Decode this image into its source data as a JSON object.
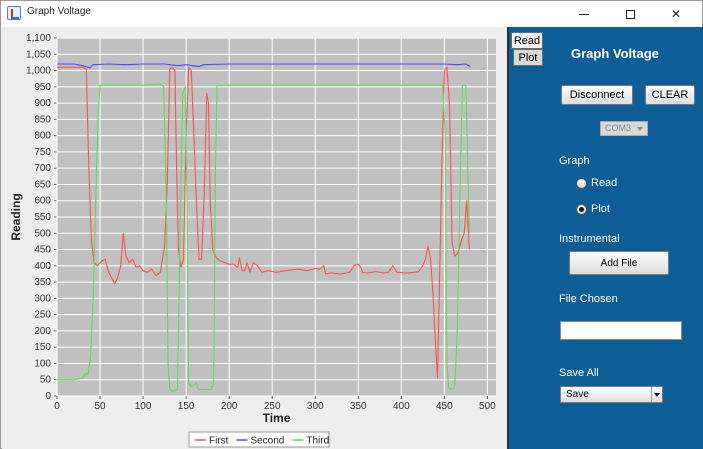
{
  "window": {
    "title": "Graph Voltage",
    "minimize_icon": "minimize-icon",
    "maximize_icon": "maximize-icon",
    "close_glyph": "✕"
  },
  "colors": {
    "plot_background": "#c0c0c0",
    "gridline": "#ffffff",
    "side_panel": "#0d5d96",
    "series_first": "#ff5050",
    "series_second": "#4a4aff",
    "series_third": "#55e055"
  },
  "tabs": {
    "read": "Read",
    "plot": "Plot"
  },
  "controls": {
    "heading": "Graph Voltage",
    "disconnect_label": "Disconnect",
    "clear_label": "CLEAR",
    "port_value": "COM3",
    "graph_label": "Graph",
    "radio_read_label": "Read",
    "radio_plot_label": "Plot",
    "radio_selected": "Plot",
    "instrumental_label": "Instrumental",
    "add_file_label": "Add File",
    "file_chosen_label": "File Chosen",
    "file_chosen_value": "",
    "save_all_label": "Save All",
    "save_value": "Save"
  },
  "chart_data": {
    "type": "line",
    "xlabel": "Time",
    "ylabel": "Reading",
    "xlim": [
      0,
      510
    ],
    "ylim": [
      0,
      1100
    ],
    "xticks": [
      0,
      50,
      100,
      150,
      200,
      250,
      300,
      350,
      400,
      450,
      500
    ],
    "yticks": [
      0,
      50,
      100,
      150,
      200,
      250,
      300,
      350,
      400,
      450,
      500,
      550,
      600,
      650,
      700,
      750,
      800,
      850,
      900,
      950,
      1000,
      1050,
      1100
    ],
    "grid": true,
    "legend_position": "bottom-center",
    "series": [
      {
        "name": "First",
        "color": "#ff5050",
        "points": [
          [
            0,
            1010
          ],
          [
            10,
            1010
          ],
          [
            20,
            1010
          ],
          [
            30,
            1010
          ],
          [
            34,
            1005
          ],
          [
            37,
            700
          ],
          [
            40,
            480
          ],
          [
            43,
            410
          ],
          [
            47,
            400
          ],
          [
            52,
            415
          ],
          [
            56,
            420
          ],
          [
            60,
            380
          ],
          [
            64,
            360
          ],
          [
            67,
            345
          ],
          [
            70,
            360
          ],
          [
            74,
            400
          ],
          [
            77,
            500
          ],
          [
            80,
            430
          ],
          [
            84,
            410
          ],
          [
            88,
            420
          ],
          [
            92,
            395
          ],
          [
            96,
            400
          ],
          [
            100,
            385
          ],
          [
            105,
            380
          ],
          [
            110,
            390
          ],
          [
            115,
            370
          ],
          [
            120,
            380
          ],
          [
            125,
            460
          ],
          [
            128,
            650
          ],
          [
            131,
            1005
          ],
          [
            134,
            1010
          ],
          [
            137,
            1000
          ],
          [
            139,
            700
          ],
          [
            141,
            450
          ],
          [
            144,
            395
          ],
          [
            147,
            420
          ],
          [
            150,
            800
          ],
          [
            153,
            1010
          ],
          [
            156,
            1000
          ],
          [
            159,
            800
          ],
          [
            162,
            600
          ],
          [
            165,
            420
          ],
          [
            168,
            420
          ],
          [
            171,
            620
          ],
          [
            174,
            930
          ],
          [
            176,
            900
          ],
          [
            178,
            600
          ],
          [
            181,
            450
          ],
          [
            185,
            425
          ],
          [
            190,
            415
          ],
          [
            195,
            410
          ],
          [
            200,
            405
          ],
          [
            205,
            405
          ],
          [
            210,
            395
          ],
          [
            212,
            425
          ],
          [
            215,
            385
          ],
          [
            218,
            385
          ],
          [
            221,
            410
          ],
          [
            224,
            380
          ],
          [
            228,
            410
          ],
          [
            233,
            400
          ],
          [
            238,
            380
          ],
          [
            245,
            385
          ],
          [
            255,
            380
          ],
          [
            265,
            385
          ],
          [
            280,
            390
          ],
          [
            290,
            385
          ],
          [
            300,
            392
          ],
          [
            305,
            390
          ],
          [
            310,
            400
          ],
          [
            312,
            375
          ],
          [
            318,
            378
          ],
          [
            330,
            375
          ],
          [
            340,
            380
          ],
          [
            345,
            400
          ],
          [
            350,
            405
          ],
          [
            353,
            395
          ],
          [
            355,
            380
          ],
          [
            360,
            378
          ],
          [
            370,
            382
          ],
          [
            380,
            378
          ],
          [
            385,
            380
          ],
          [
            390,
            400
          ],
          [
            395,
            380
          ],
          [
            405,
            378
          ],
          [
            415,
            380
          ],
          [
            420,
            382
          ],
          [
            425,
            400
          ],
          [
            428,
            420
          ],
          [
            431,
            460
          ],
          [
            434,
            420
          ],
          [
            437,
            300
          ],
          [
            440,
            150
          ],
          [
            442,
            55
          ],
          [
            444,
            300
          ],
          [
            447,
            700
          ],
          [
            450,
            1000
          ],
          [
            453,
            1010
          ],
          [
            456,
            900
          ],
          [
            459,
            470
          ],
          [
            462,
            430
          ],
          [
            466,
            440
          ],
          [
            470,
            480
          ],
          [
            473,
            500
          ],
          [
            476,
            600
          ],
          [
            479,
            450
          ]
        ]
      },
      {
        "name": "Second",
        "color": "#4a4aff",
        "points": [
          [
            0,
            1020
          ],
          [
            20,
            1020
          ],
          [
            30,
            1015
          ],
          [
            38,
            1008
          ],
          [
            42,
            1018
          ],
          [
            60,
            1020
          ],
          [
            80,
            1018
          ],
          [
            100,
            1020
          ],
          [
            125,
            1020
          ],
          [
            140,
            1015
          ],
          [
            150,
            1018
          ],
          [
            165,
            1012
          ],
          [
            170,
            1018
          ],
          [
            200,
            1020
          ],
          [
            260,
            1020
          ],
          [
            300,
            1020
          ],
          [
            340,
            1020
          ],
          [
            380,
            1020
          ],
          [
            420,
            1020
          ],
          [
            450,
            1020
          ],
          [
            465,
            1018
          ],
          [
            475,
            1020
          ],
          [
            480,
            1012
          ]
        ]
      },
      {
        "name": "Third",
        "color": "#55e055",
        "points": [
          [
            0,
            50
          ],
          [
            10,
            50
          ],
          [
            20,
            50
          ],
          [
            30,
            55
          ],
          [
            33,
            70
          ],
          [
            36,
            65
          ],
          [
            39,
            120
          ],
          [
            42,
            300
          ],
          [
            45,
            600
          ],
          [
            48,
            870
          ],
          [
            50,
            955
          ],
          [
            60,
            955
          ],
          [
            80,
            955
          ],
          [
            100,
            955
          ],
          [
            120,
            958
          ],
          [
            124,
            950
          ],
          [
            127,
            600
          ],
          [
            129,
            100
          ],
          [
            131,
            20
          ],
          [
            134,
            15
          ],
          [
            137,
            15
          ],
          [
            140,
            20
          ],
          [
            143,
            500
          ],
          [
            146,
            930
          ],
          [
            149,
            950
          ],
          [
            151,
            600
          ],
          [
            153,
            40
          ],
          [
            156,
            30
          ],
          [
            159,
            35
          ],
          [
            162,
            40
          ],
          [
            164,
            20
          ],
          [
            167,
            20
          ],
          [
            170,
            20
          ],
          [
            173,
            20
          ],
          [
            176,
            20
          ],
          [
            179,
            20
          ],
          [
            182,
            40
          ],
          [
            184,
            700
          ],
          [
            186,
            955
          ],
          [
            200,
            955
          ],
          [
            250,
            955
          ],
          [
            300,
            955
          ],
          [
            350,
            955
          ],
          [
            400,
            955
          ],
          [
            440,
            955
          ],
          [
            448,
            955
          ],
          [
            451,
            800
          ],
          [
            453,
            100
          ],
          [
            455,
            25
          ],
          [
            458,
            20
          ],
          [
            462,
            25
          ],
          [
            465,
            200
          ],
          [
            468,
            600
          ],
          [
            471,
            955
          ],
          [
            475,
            955
          ],
          [
            479,
            500
          ]
        ]
      }
    ]
  }
}
